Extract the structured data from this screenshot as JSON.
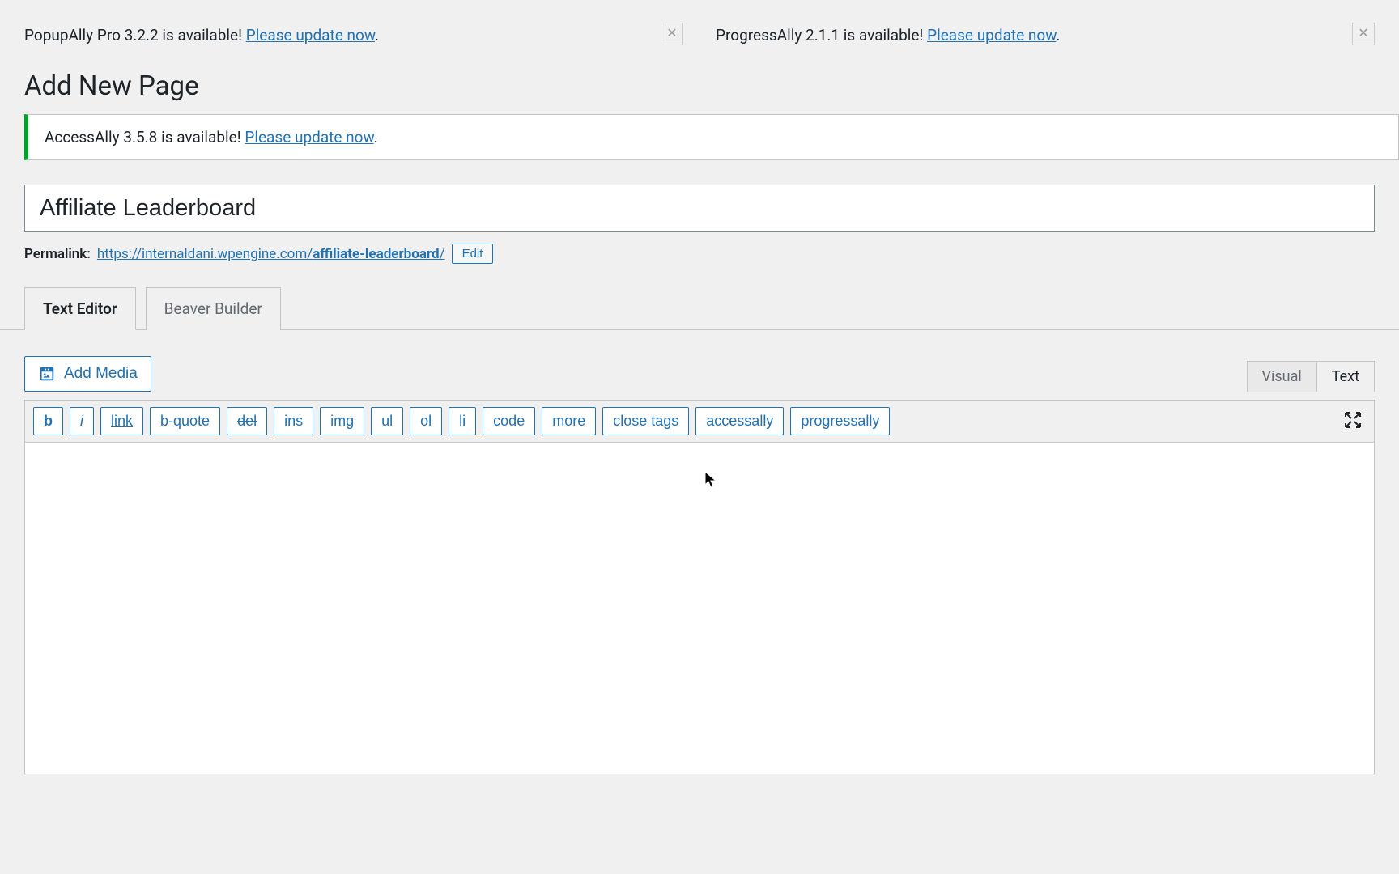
{
  "notices": {
    "popupally": {
      "text_prefix": "PopupAlly Pro 3.2.2 is available! ",
      "link": "Please update now",
      "suffix": "."
    },
    "progressally_top": {
      "text_prefix": "ProgressAlly 2.1.1 is available! ",
      "link": "Please update now",
      "suffix": "."
    },
    "accessally": {
      "text_prefix": "AccessAlly 3.5.8 is available! ",
      "link": "Please update now",
      "suffix": "."
    }
  },
  "page": {
    "heading": "Add New Page",
    "title_value": "Affiliate Leaderboard"
  },
  "permalink": {
    "label": "Permalink:",
    "base": "https://internaldani.wpengine.com/",
    "slug": "affiliate-leaderboard",
    "trail": "/",
    "edit": "Edit"
  },
  "tabs": {
    "text_editor": "Text Editor",
    "beaver": "Beaver Builder"
  },
  "media": {
    "add": "Add Media"
  },
  "views": {
    "visual": "Visual",
    "text": "Text"
  },
  "quicktags": {
    "b": "b",
    "i": "i",
    "link": "link",
    "bquote": "b-quote",
    "del": "del",
    "ins": "ins",
    "img": "img",
    "ul": "ul",
    "ol": "ol",
    "li": "li",
    "code": "code",
    "more": "more",
    "close": "close tags",
    "accessally": "accessally",
    "progressally": "progressally"
  }
}
